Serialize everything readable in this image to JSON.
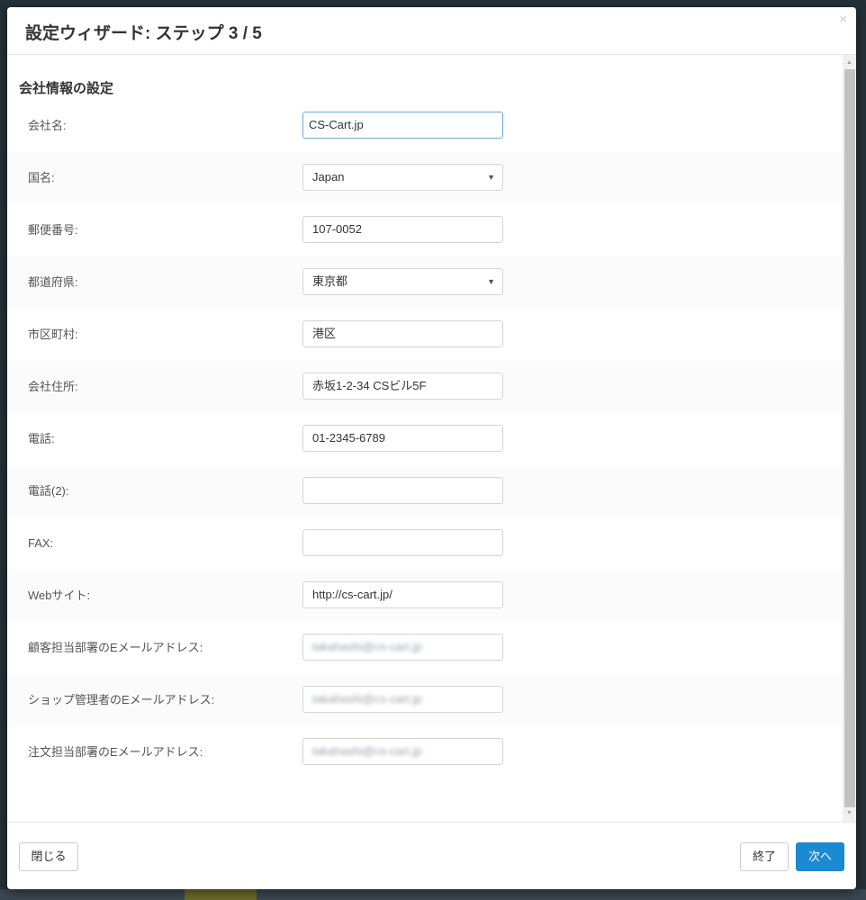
{
  "modal": {
    "title": "設定ウィザード: ステップ 3 / 5",
    "close_icon": "×"
  },
  "form": {
    "section_title": "会社情報の設定",
    "fields": [
      {
        "label": "会社名:",
        "type": "text",
        "value": "CS-Cart.jp"
      },
      {
        "label": "国名:",
        "type": "select",
        "value": "Japan"
      },
      {
        "label": "郵便番号:",
        "type": "text",
        "value": "107-0052"
      },
      {
        "label": "都道府県:",
        "type": "select",
        "value": "東京都"
      },
      {
        "label": "市区町村:",
        "type": "text",
        "value": "港区"
      },
      {
        "label": "会社住所:",
        "type": "text",
        "value": "赤坂1-2-34 CSビル5F"
      },
      {
        "label": "電話:",
        "type": "text",
        "value": "01-2345-6789"
      },
      {
        "label": "電話(2):",
        "type": "text",
        "value": ""
      },
      {
        "label": "FAX:",
        "type": "text",
        "value": ""
      },
      {
        "label": "Webサイト:",
        "type": "text",
        "value": "http://cs-cart.jp/"
      },
      {
        "label": "顧客担当部署のEメールアドレス:",
        "type": "email",
        "value": "takahashi@cs-cart.jp"
      },
      {
        "label": "ショップ管理者のEメールアドレス:",
        "type": "email",
        "value": "takahashi@cs-cart.jp"
      },
      {
        "label": "注文担当部署のEメールアドレス:",
        "type": "email",
        "value": "takahashi@cs-cart.jp"
      }
    ]
  },
  "icons": {
    "select_arrow": "▼",
    "scroll_up": "▲",
    "scroll_down": "▼"
  },
  "footer": {
    "close_label": "閉じる",
    "finish_label": "終了",
    "next_label": "次へ"
  },
  "colors": {
    "primary": "#1a8ad4",
    "focus_border": "#6fa7d8"
  }
}
